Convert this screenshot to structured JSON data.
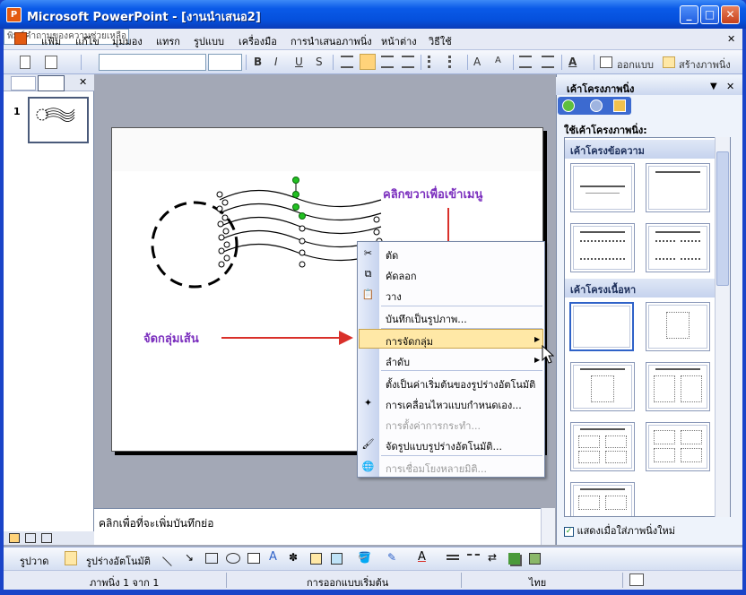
{
  "window": {
    "icon_label": "P",
    "title": "Microsoft PowerPoint - [งานนำเสนอ2]",
    "minimize": "_",
    "maximize": "□",
    "close": "✕"
  },
  "menu": {
    "items": [
      "แฟ้ม",
      "แก้ไข",
      "มุมมอง",
      "แทรก",
      "รูปแบบ",
      "เครื่องมือ",
      "การนำเสนอภาพนิ่ง",
      "หน้าต่าง",
      "วิธีใช้"
    ],
    "help_placeholder": "พิมพ์คำถามของความช่วยเหลือ",
    "close_doc": "✕"
  },
  "formatting": {
    "bold": "B",
    "italic": "I",
    "underline": "U",
    "shadow": "S",
    "design_label": "ออกแบบ",
    "new_slide_label": "สร้างภาพนิ่ง"
  },
  "thumbnails": {
    "slide_number": "1",
    "close": "✕"
  },
  "notes": {
    "placeholder": "คลิกเพื่อที่จะเพิ่มบันทึกย่อ"
  },
  "annotations": {
    "right_click": "คลิกขวาเพื่อเข้าเมนู",
    "group_lines": "จัดกลุ่มเส้น",
    "annotation_color": "#7b2fbe",
    "arrow_color": "#d9302a"
  },
  "context_menu": {
    "cut": "ตัด",
    "copy": "คัดลอก",
    "paste": "วาง",
    "save_as_picture": "บันทึกเป็นรูปภาพ...",
    "grouping": "การจัดกลุ่ม",
    "order": "ลำดับ",
    "set_default": "ตั้งเป็นค่าเริ่มต้นของรูปร่างอัตโนมัติ",
    "custom_animation": "การเคลื่อนไหวแบบกำหนดเอง...",
    "action_settings": "การตั้งค่าการกระทำ...",
    "format_autoshape": "จัดรูปแบบรูปร่างอัตโนมัติ...",
    "hyperlink": "การเชื่อมโยงหลายมิติ..."
  },
  "taskpane": {
    "title": "เค้าโครงภาพนิ่ง",
    "dropdown": "▼",
    "close": "✕",
    "apply_label": "ใช้เค้าโครงภาพนิ่ง:",
    "section_text": "เค้าโครงข้อความ",
    "section_content": "เค้าโครงเนื้อหา",
    "show_on_insert": "แสดงเมื่อใส่ภาพนิ่งใหม่"
  },
  "drawing": {
    "draw_label": "รูปวาด",
    "autoshapes_label": "รูปร่างอัตโนมัติ"
  },
  "status": {
    "slide": "ภาพนิ่ง 1 จาก 1",
    "design": "การออกแบบเริ่มต้น",
    "language": "ไทย"
  }
}
